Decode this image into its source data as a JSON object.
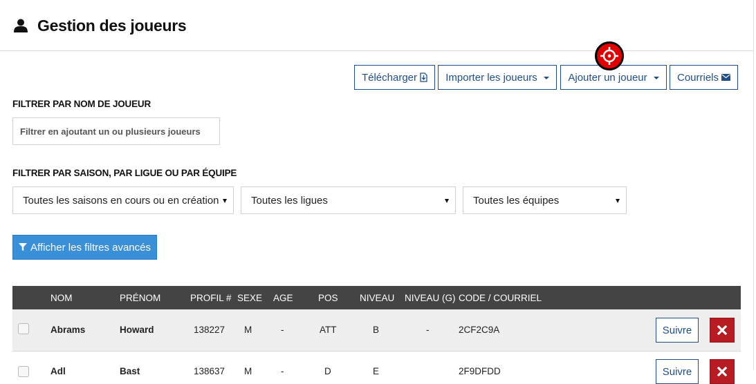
{
  "header": {
    "title": "Gestion des joueurs",
    "icon": "user-icon"
  },
  "toolbar": {
    "download_label": "Télécharger",
    "import_label": "Importer les joueurs",
    "add_label": "Ajouter un joueur",
    "emails_label": "Courriels",
    "accent_color": "#1f4e86"
  },
  "filters": {
    "name_label": "FILTRER PAR NOM DE JOUEUR",
    "name_placeholder": "Filtrer en ajoutant un ou plusieurs joueurs",
    "scope_label": "FILTRER PAR SAISON, PAR LIGUE OU PAR ÉQUIPE",
    "season_value": "Toutes les saisons en cours ou en création",
    "league_value": "Toutes les ligues",
    "team_value": "Toutes les équipes",
    "advanced_label": "Afficher les filtres avancés"
  },
  "table": {
    "columns": [
      "NOM",
      "PRÉNOM",
      "PROFIL #",
      "SEXE",
      "AGE",
      "POS",
      "NIVEAU",
      "NIVEAU (G)",
      "CODE / COURRIEL"
    ],
    "rows": [
      {
        "nom": "Abrams",
        "prenom": "Howard",
        "profil": "138227",
        "sexe": "M",
        "age": "-",
        "pos": "ATT",
        "niveau": "B",
        "niveau_g": "-",
        "code": "2CF2C9A",
        "follow_label": "Suivre"
      },
      {
        "nom": "Adl",
        "prenom": "Bast",
        "profil": "138637",
        "sexe": "M",
        "age": "-",
        "pos": "D",
        "niveau": "E",
        "niveau_g": "",
        "code": "2F9DFDD",
        "follow_label": "Suivre"
      }
    ]
  },
  "colors": {
    "header_bg": "#444444",
    "row_bg": "#eeeeee",
    "primary_btn": "#3a8fd9",
    "danger_btn": "#b81c23"
  }
}
